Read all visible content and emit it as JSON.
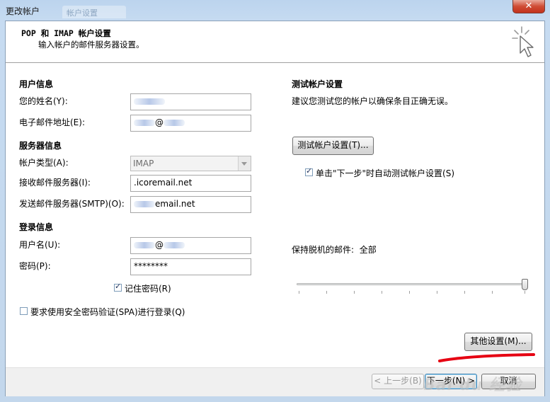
{
  "window": {
    "title": "更改帐户",
    "ghost_tab": "帐户设置",
    "close_glyph": "✕"
  },
  "header": {
    "title": "POP 和 IMAP 帐户设置",
    "subtitle": "输入帐户的邮件服务器设置。",
    "icon": "cursor-sparkle-icon"
  },
  "user_info": {
    "section": "用户信息",
    "name_label": "您的姓名(Y):",
    "name_value": "",
    "email_label": "电子邮件地址(E):",
    "email_value": "@"
  },
  "server_info": {
    "section": "服务器信息",
    "account_type_label": "帐户类型(A):",
    "account_type_value": "IMAP",
    "incoming_label": "接收邮件服务器(I):",
    "incoming_value": ".icoremail.net",
    "outgoing_label": "发送邮件服务器(SMTP)(O):",
    "outgoing_value": "email.net"
  },
  "login_info": {
    "section": "登录信息",
    "username_label": "用户名(U):",
    "username_value": "@",
    "password_label": "密码(P):",
    "password_value": "********",
    "remember_label": "记住密码(R)",
    "remember_checked": true,
    "spa_label": "要求使用安全密码验证(SPA)进行登录(Q)",
    "spa_checked": false
  },
  "test": {
    "section": "测试帐户设置",
    "description": "建议您测试您的帐户以确保条目正确无误。",
    "button": "测试帐户设置(T)...",
    "auto_label": "单击\"下一步\"时自动测试帐户设置(S)",
    "auto_checked": true
  },
  "offline": {
    "label": "保持脱机的邮件:",
    "value": "全部",
    "level_percent": 100
  },
  "buttons": {
    "more_settings": "其他设置(M)...",
    "back": "< 上一步(B)",
    "next": "下一步(N) >",
    "cancel": "取消"
  },
  "watermark": "Bai du 经验",
  "colors": {
    "accent": "#3c7fb1",
    "annotation": "#e60012",
    "close": "#c3321c"
  }
}
